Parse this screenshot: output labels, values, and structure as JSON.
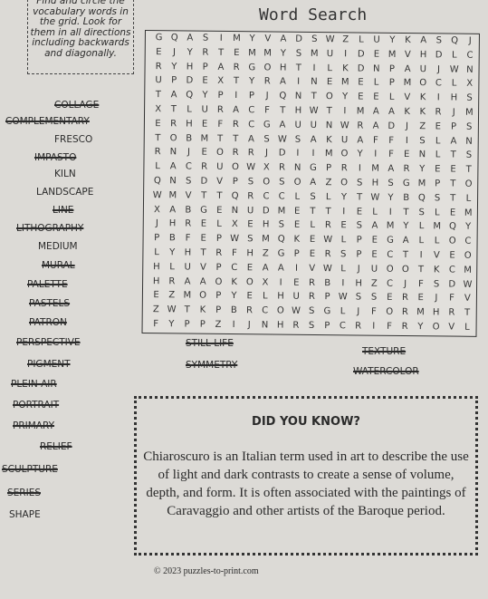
{
  "instructions": "Find and circle the vocabulary words in the grid. Look for them in all directions including backwards and diagonally.",
  "title": "Word Search",
  "grid": [
    "GQASIMYVADSWZLUYKASQJ",
    "EJYRTEMMYSMUIDEMVHDLC",
    "RYHPARGOHTILKDNPAUJWN",
    "UPDEXTYRAINEMELPMOCLX",
    "TAQYPIPJQNTOYEELVKIHS",
    "XTLURACFTHWTIMAAKKRJM",
    "ERHEFRCGAUUNWRADJZEPS",
    "TOBMTTASWSAKUAFFISLAN",
    "RNJEORRJDIIMOYIFENLTS",
    "LACRUOWXRNGPRIMARYEET",
    "QNSDVPSOSOAZOSHSGMPTO",
    "WMVTTQRCCLSLYTWYBQSTL",
    "XABGENUDMETTIELITSLEM",
    "JHRELXEHSELRESAMYLMQY",
    "PBFEPWSMQKEWLPEGALLOC",
    "LYHTRFHZGPERSPECTIVEO",
    "HLUVPCEAAIVWLJUOOTKCM",
    "HRAAOKOXIERBIHZCJFSDW",
    "EZMOPYELHURPWSSEREJFV",
    "ZWTKPBRCOWSGLJFORMHRT",
    "FYPPZIJNHRSPCRIFRYOVL"
  ],
  "words": [
    {
      "text": "COLLAGE",
      "found": true
    },
    {
      "text": "COMPLEMENTARY",
      "found": true
    },
    {
      "text": "FRESCO",
      "found": false
    },
    {
      "text": "IMPASTO",
      "found": true
    },
    {
      "text": "KILN",
      "found": false
    },
    {
      "text": "LANDSCAPE",
      "found": false
    },
    {
      "text": "LINE",
      "found": true
    },
    {
      "text": "LITHOGRAPHY",
      "found": true
    },
    {
      "text": "MEDIUM",
      "found": false
    },
    {
      "text": "MURAL",
      "found": true
    },
    {
      "text": "PALETTE",
      "found": true
    },
    {
      "text": "PASTELS",
      "found": true
    },
    {
      "text": "PATRON",
      "found": true
    },
    {
      "text": "PERSPECTIVE",
      "found": true
    },
    {
      "text": "PIGMENT",
      "found": true
    },
    {
      "text": "PLEIN AIR",
      "found": true
    },
    {
      "text": "PORTRAIT",
      "found": true
    },
    {
      "text": "PRIMARY",
      "found": true
    },
    {
      "text": "RELIEF",
      "found": true
    },
    {
      "text": "SCULPTURE",
      "found": true
    },
    {
      "text": "SERIES",
      "found": true
    },
    {
      "text": "SHAPE",
      "found": false
    },
    {
      "text": "STILL LIFE",
      "found": true
    },
    {
      "text": "SYMMETRY",
      "found": true
    },
    {
      "text": "TEXTURE",
      "found": true
    },
    {
      "text": "WATERCOLOR",
      "found": true
    }
  ],
  "did_you_know": {
    "title": "DID YOU KNOW?",
    "body": "Chiaroscuro is an Italian term used in art to describe the use of light and dark contrasts to create a sense of volume, depth, and form. It is often associated with the paintings of Caravaggio and other artists of the Baroque period."
  },
  "copyright": "© 2023 puzzles-to-print.com"
}
